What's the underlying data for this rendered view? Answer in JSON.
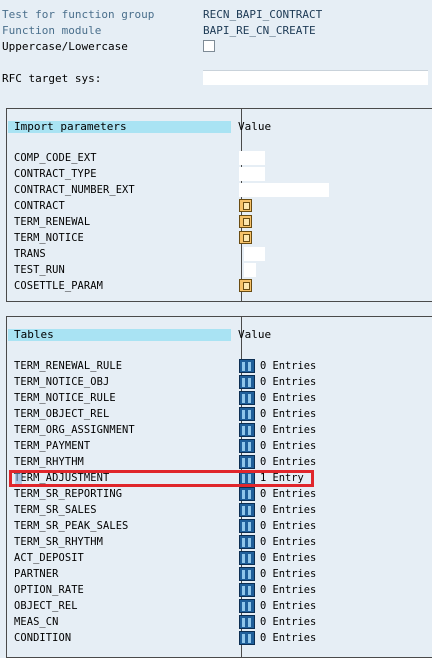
{
  "header": {
    "function_group_label": "Test for function group",
    "function_group_value": "RECN_BAPI_CONTRACT",
    "function_module_label": "Function module",
    "function_module_value": "BAPI_RE_CN_CREATE",
    "case_label": "Uppercase/Lowercase",
    "rfc_label": "RFC target sys:",
    "rfc_value": ""
  },
  "import_panel": {
    "title": "Import parameters",
    "value_title": "Value",
    "params": [
      {
        "name": "COMP_CODE_EXT",
        "type": "field"
      },
      {
        "name": "CONTRACT_TYPE",
        "type": "field"
      },
      {
        "name": "CONTRACT_NUMBER_EXT",
        "type": "field"
      },
      {
        "name": "CONTRACT",
        "type": "structure"
      },
      {
        "name": "TERM_RENEWAL",
        "type": "structure"
      },
      {
        "name": "TERM_NOTICE",
        "type": "structure"
      },
      {
        "name": "TRANS",
        "type": "field"
      },
      {
        "name": "TEST_RUN",
        "type": "field"
      },
      {
        "name": "COSETTLE_PARAM",
        "type": "structure"
      }
    ]
  },
  "tables_panel": {
    "title": "Tables",
    "value_title": "Value",
    "tables": [
      {
        "name": "TERM_RENEWAL_RULE",
        "entries": "0 Entries"
      },
      {
        "name": "TERM_NOTICE_OBJ",
        "entries": "0 Entries"
      },
      {
        "name": "TERM_NOTICE_RULE",
        "entries": "0 Entries"
      },
      {
        "name": "TERM_OBJECT_REL",
        "entries": "0 Entries"
      },
      {
        "name": "TERM_ORG_ASSIGNMENT",
        "entries": "0 Entries"
      },
      {
        "name": "TERM_PAYMENT",
        "entries": "0 Entries"
      },
      {
        "name": "TERM_RHYTHM",
        "entries": "0 Entries"
      },
      {
        "name": "TERM_ADJUSTMENT",
        "entries": "1 Entry"
      },
      {
        "name": "TERM_SR_REPORTING",
        "entries": "0 Entries"
      },
      {
        "name": "TERM_SR_SALES",
        "entries": "0 Entries"
      },
      {
        "name": "TERM_SR_PEAK_SALES",
        "entries": "0 Entries"
      },
      {
        "name": "TERM_SR_RHYTHM",
        "entries": "0 Entries"
      },
      {
        "name": "ACT_DEPOSIT",
        "entries": "0 Entries"
      },
      {
        "name": "PARTNER",
        "entries": "0 Entries"
      },
      {
        "name": "OPTION_RATE",
        "entries": "0 Entries"
      },
      {
        "name": "OBJECT_REL",
        "entries": "0 Entries"
      },
      {
        "name": "MEAS_CN",
        "entries": "0 Entries"
      },
      {
        "name": "CONDITION",
        "entries": "0 Entries"
      }
    ]
  },
  "colors": {
    "background": "#e6eef5",
    "section_header": "#a9e3f3",
    "highlight_border": "#e0262b"
  }
}
